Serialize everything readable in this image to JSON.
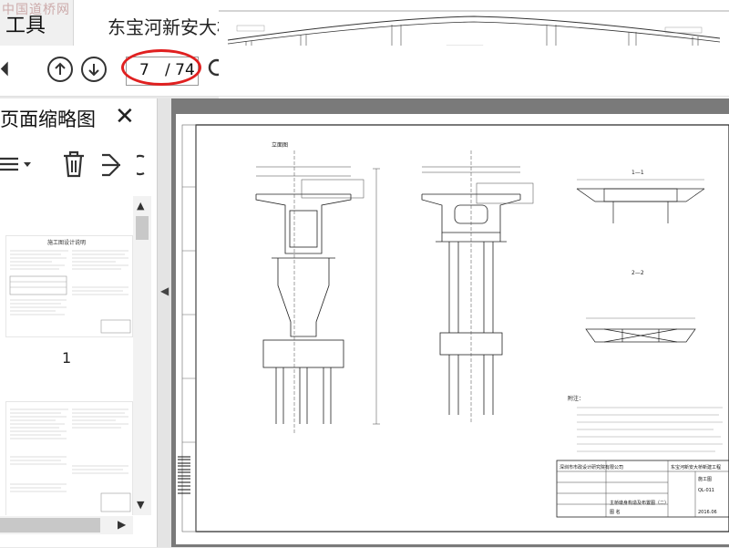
{
  "watermark": "中国道桥网",
  "titlebar": {
    "tools_tab": "工具",
    "document_tab": "东宝河新安大桥"
  },
  "toolbar": {
    "current_page": "7",
    "total_pages": "/ 74"
  },
  "sidebar": {
    "title": "页面缩略图",
    "thumbnail_page_number": "1",
    "thumb_header": "施工图设计说明"
  },
  "drawing": {
    "sheet_title": "立面图",
    "pier_sections": [
      "1—1",
      "2—2"
    ],
    "notes_title": "附注：",
    "company": "深圳市市政设计研究院有限公司",
    "project": "东宝河新安大桥新建工程",
    "sheet_name": "主桥墩身构造及布置图（二）",
    "drawing_no": "QL-011",
    "sheet_label": "图 名",
    "date": "2016.06",
    "stamp": "施工图"
  },
  "colors": {
    "annotation_red": "#e02020",
    "panel_bg": "#ffffff",
    "doc_bg": "#7a7a7a"
  }
}
